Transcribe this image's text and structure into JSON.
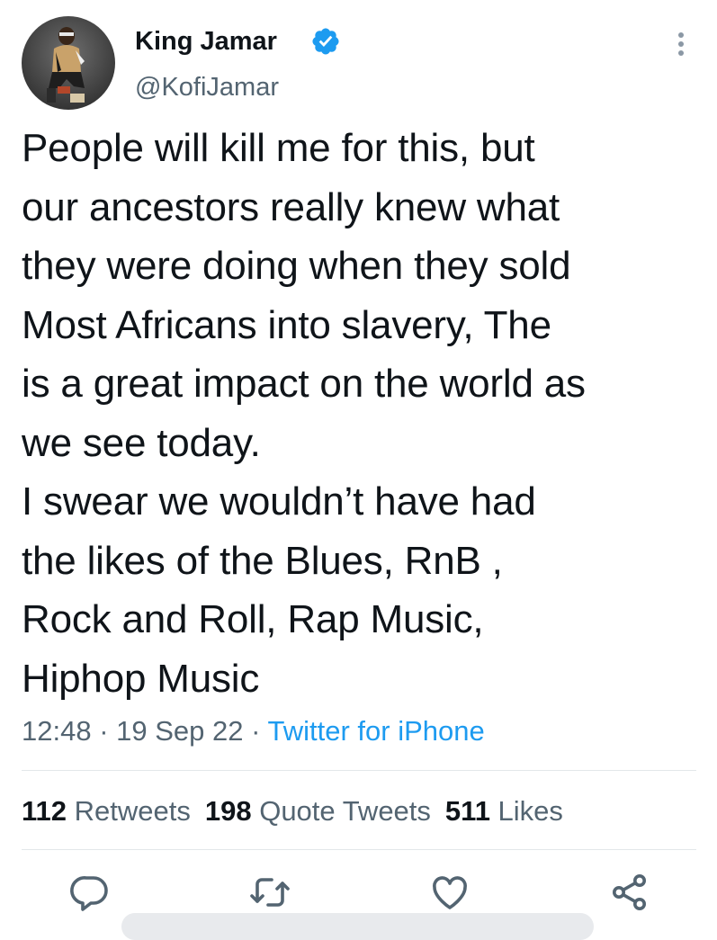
{
  "header": {
    "display_name": "King Jamar",
    "handle": "@KofiJamar",
    "avatar_icon": "profile-photo",
    "verified_icon": "verified-badge-icon",
    "verified_color": "#1d9bf0",
    "more_icon": "more-vertical-icon"
  },
  "tweet": {
    "lines": [
      "People will kill me for this, but",
      "our ancestors really knew what",
      "they were doing when they sold",
      "Most Africans into slavery, The",
      "is a great impact on the world as",
      "we see today.",
      "I swear we wouldn’t have had",
      "the likes of the Blues, RnB ,",
      "Rock and Roll, Rap Music,",
      "Hiphop Music"
    ]
  },
  "meta": {
    "time": "12:48",
    "separator": " · ",
    "date": "19 Sep 22",
    "source": "Twitter for iPhone",
    "source_color": "#1d9bf0"
  },
  "stats": {
    "retweets_count": "112",
    "retweets_label": " Retweets",
    "quotes_count": "198",
    "quotes_label": " Quote Tweets",
    "likes_count": "511",
    "likes_label": " Likes"
  },
  "actions": {
    "reply_icon": "reply-icon",
    "retweet_icon": "retweet-icon",
    "like_icon": "heart-icon",
    "share_icon": "share-icon"
  }
}
